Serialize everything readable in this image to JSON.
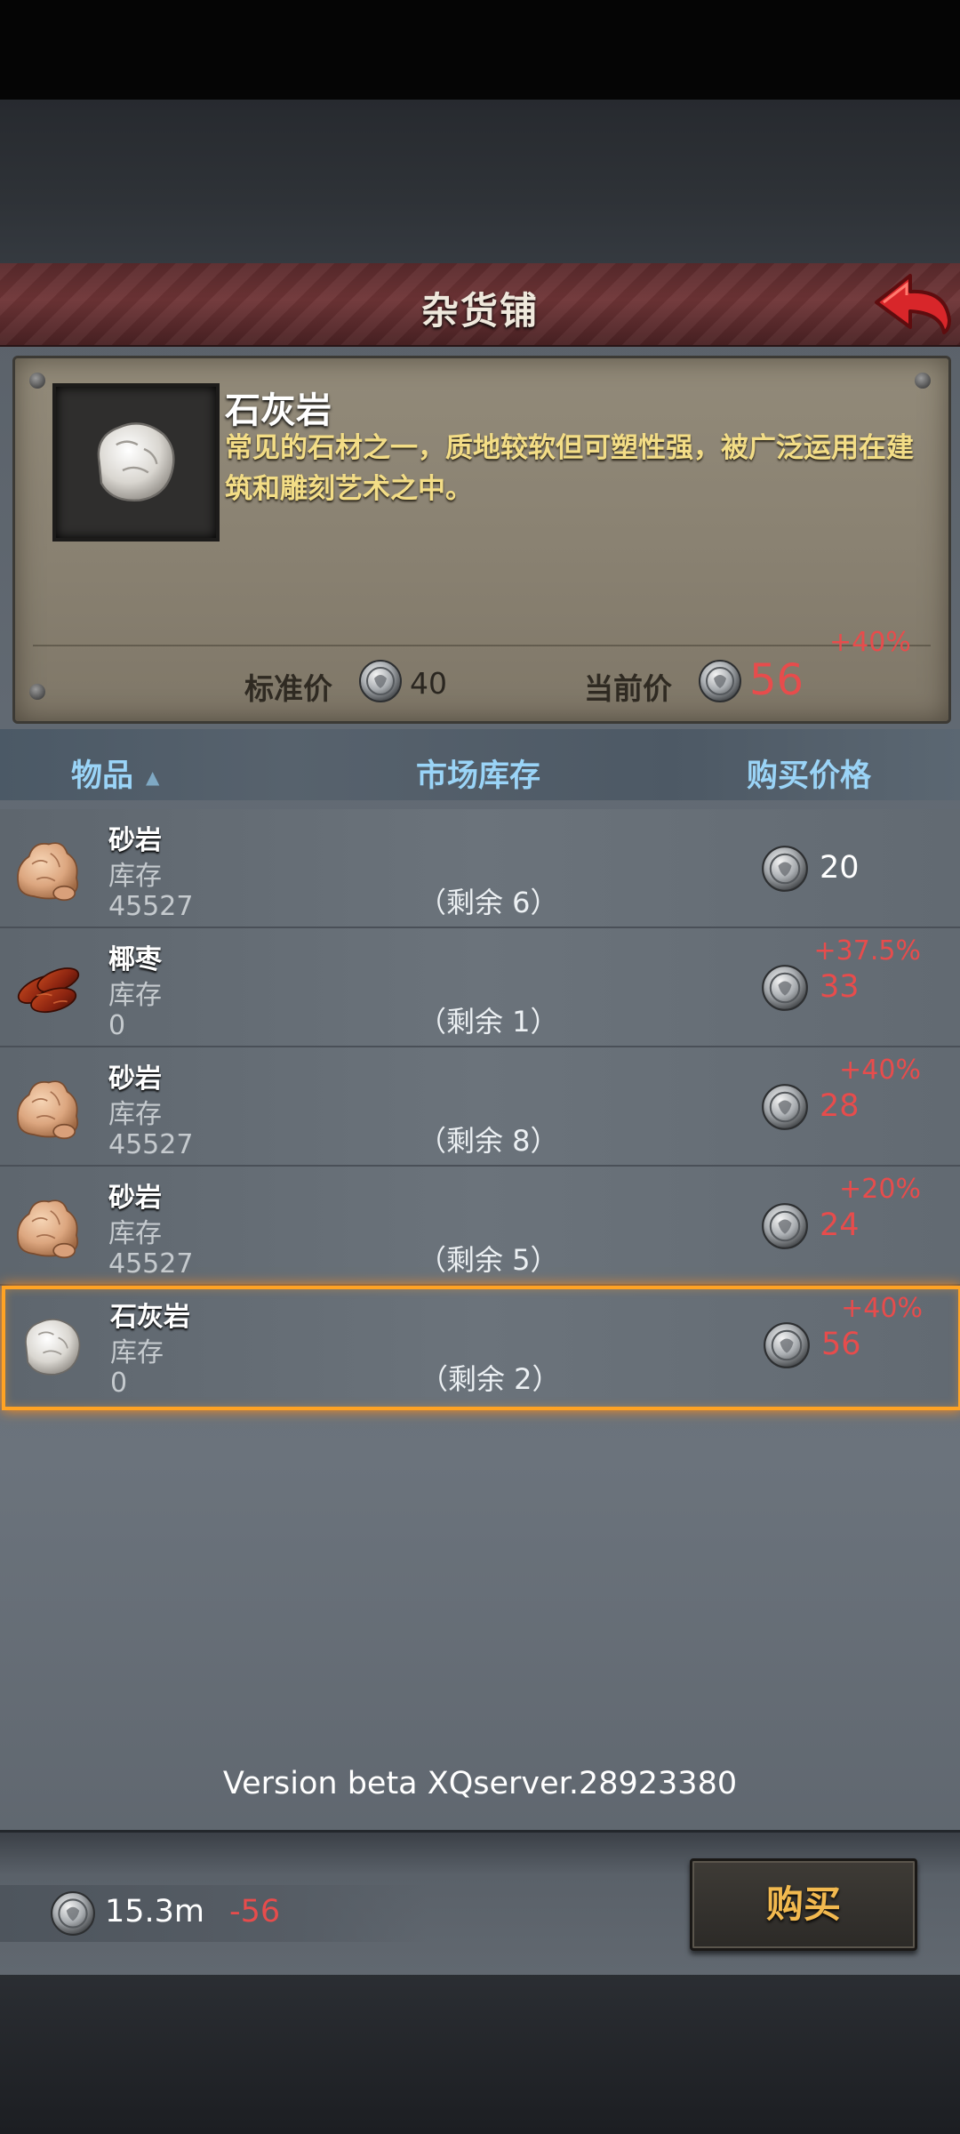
{
  "shop": {
    "title": "杂货铺"
  },
  "detail": {
    "name": "石灰岩",
    "description": "常见的石材之一，质地较软但可塑性强，被广泛运用在建筑和雕刻艺术之中。",
    "standard_price_label": "标准价",
    "standard_price": "40",
    "current_price_label": "当前价",
    "current_price": "56",
    "markup": "+40%"
  },
  "headers": {
    "item": "物品",
    "sort_indicator": "▲",
    "market_stock": "市场库存",
    "buy_price": "购买价格"
  },
  "items": [
    {
      "name": "砂岩",
      "stock_label": "库存",
      "stock": "45527",
      "remaining": "（剩余 6）",
      "price": "20",
      "markup": "",
      "icon": "sandstone-icon"
    },
    {
      "name": "椰枣",
      "stock_label": "库存",
      "stock": "0",
      "remaining": "（剩余 1）",
      "price": "33",
      "markup": "+37.5%",
      "icon": "dates-icon"
    },
    {
      "name": "砂岩",
      "stock_label": "库存",
      "stock": "45527",
      "remaining": "（剩余 8）",
      "price": "28",
      "markup": "+40%",
      "icon": "sandstone-icon"
    },
    {
      "name": "砂岩",
      "stock_label": "库存",
      "stock": "45527",
      "remaining": "（剩余 5）",
      "price": "24",
      "markup": "+20%",
      "icon": "sandstone-icon"
    },
    {
      "name": "石灰岩",
      "stock_label": "库存",
      "stock": "0",
      "remaining": "（剩余 2）",
      "price": "56",
      "markup": "+40%",
      "icon": "limestone-icon",
      "selected": true
    }
  ],
  "version": "Version beta XQserver.28923380",
  "wallet": {
    "balance": "15.3m",
    "delta": "-56"
  },
  "buy_button": "购买",
  "colors": {
    "title_bar": "#6e3436",
    "description_text": "#f3dd86",
    "header_text": "#9ad4f7",
    "markup_red": "#e74c4c",
    "selected_border": "#ffa324",
    "buy_text": "#f2b94f"
  }
}
